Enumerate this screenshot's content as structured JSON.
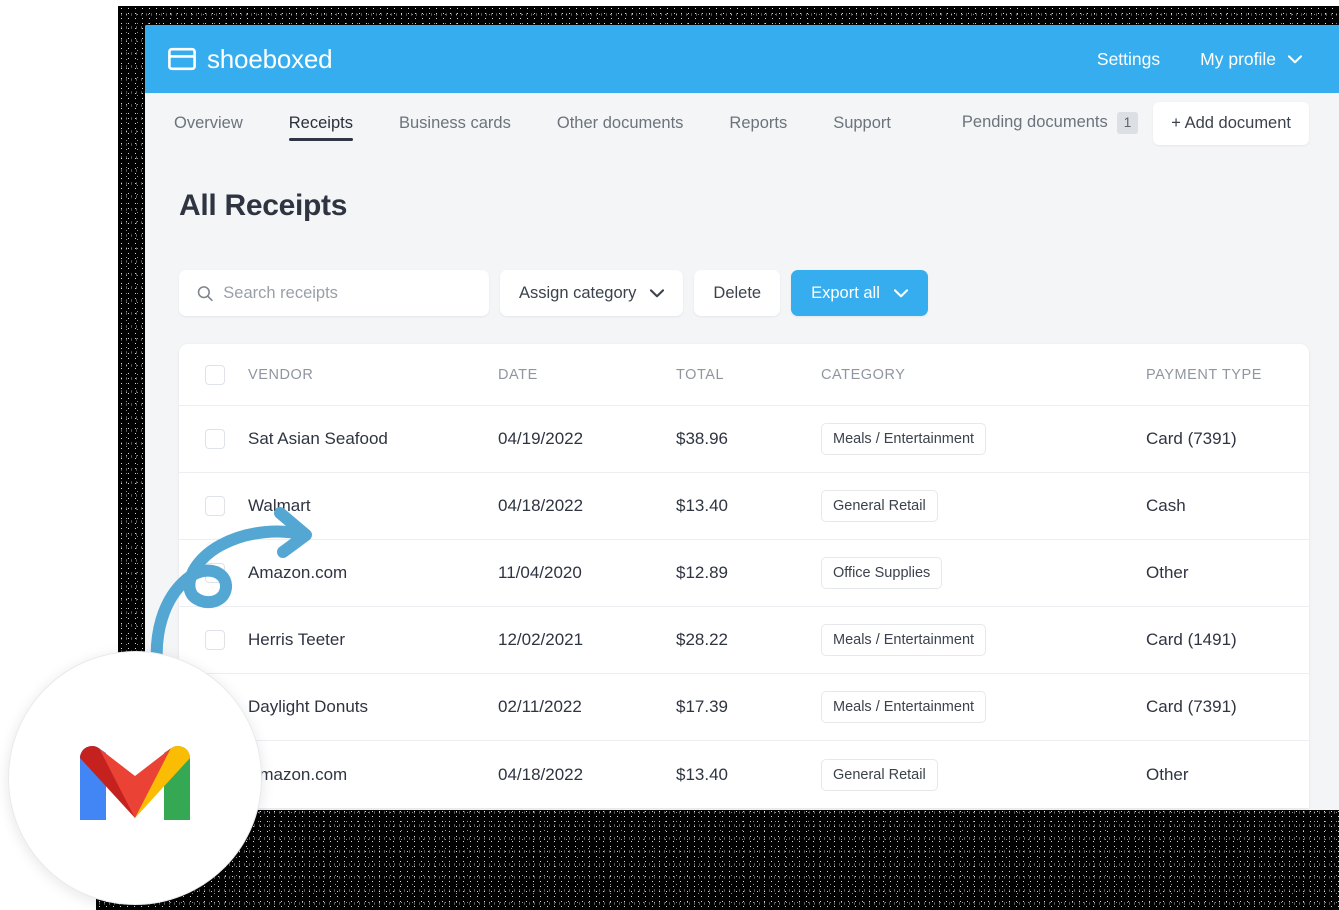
{
  "brand": {
    "name": "shoeboxed",
    "logo_icon": "shoebox-icon",
    "bar_color": "#35adee"
  },
  "topbar": {
    "settings_label": "Settings",
    "profile_label": "My profile",
    "profile_caret_icon": "chevron-down-icon"
  },
  "nav": {
    "tabs": [
      {
        "label": "Overview",
        "active": false
      },
      {
        "label": "Receipts",
        "active": true
      },
      {
        "label": "Business cards",
        "active": false
      },
      {
        "label": "Other documents",
        "active": false
      },
      {
        "label": "Reports",
        "active": false
      },
      {
        "label": "Support",
        "active": false
      }
    ],
    "pending_label": "Pending documents",
    "pending_count": "1",
    "add_document_label": "+ Add document"
  },
  "page": {
    "title": "All Receipts"
  },
  "toolbar": {
    "search_icon": "search-icon",
    "search_value": "",
    "search_placeholder": "Search receipts",
    "assign_category_label": "Assign category",
    "delete_label": "Delete",
    "export_all_label": "Export all",
    "caret_icon": "chevron-down-icon",
    "primary_color": "#35adee"
  },
  "table": {
    "columns": [
      "VENDOR",
      "DATE",
      "TOTAL",
      "CATEGORY",
      "PAYMENT TYPE"
    ],
    "rows": [
      {
        "vendor": "Sat Asian Seafood",
        "date": "04/19/2022",
        "total": "$38.96",
        "category": "Meals / Entertainment",
        "payment": "Card (7391)"
      },
      {
        "vendor": "Walmart",
        "date": "04/18/2022",
        "total": "$13.40",
        "category": "General Retail",
        "payment": "Cash"
      },
      {
        "vendor": "Amazon.com",
        "date": "11/04/2020",
        "total": "$12.89",
        "category": "Office Supplies",
        "payment": "Other"
      },
      {
        "vendor": "Herris Teeter",
        "date": "12/02/2021",
        "total": "$28.22",
        "category": "Meals / Entertainment",
        "payment": "Card (1491)"
      },
      {
        "vendor": "Daylight Donuts",
        "date": "02/11/2022",
        "total": "$17.39",
        "category": "Meals / Entertainment",
        "payment": "Card (7391)"
      },
      {
        "vendor": "Amazon.com",
        "date": "04/18/2022",
        "total": "$13.40",
        "category": "General Retail",
        "payment": "Other"
      }
    ]
  },
  "overlay": {
    "gmail_badge_icon": "gmail-icon",
    "arrow_icon": "curved-arrow-icon",
    "arrow_color": "#55a7d3"
  }
}
